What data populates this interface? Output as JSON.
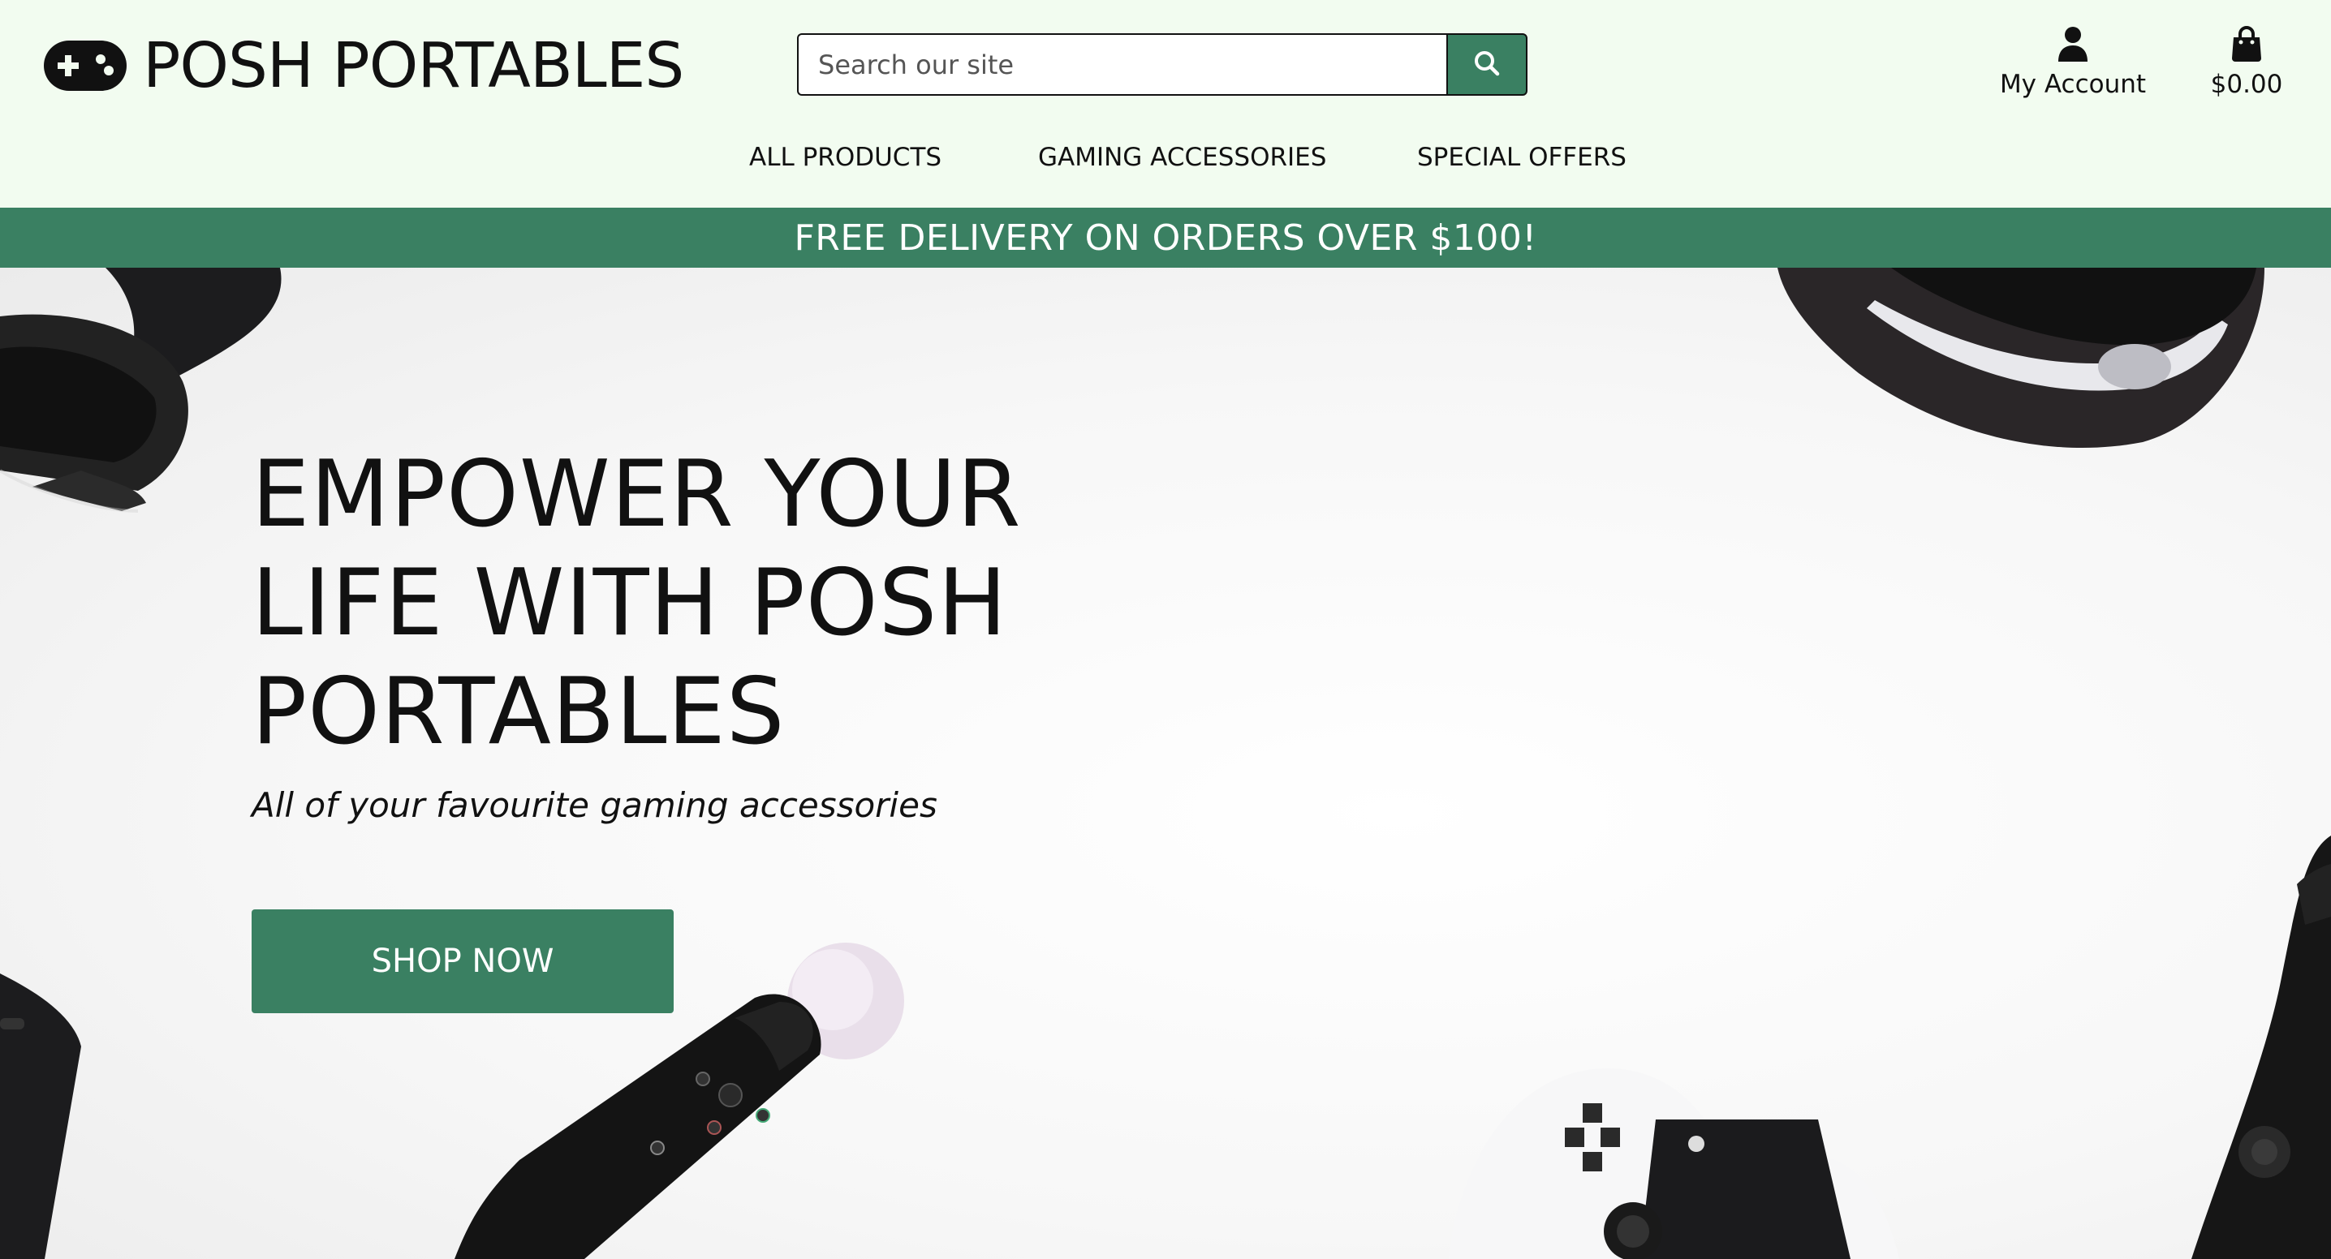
{
  "header": {
    "logo_text": "POSH PORTABLES",
    "logo_icon": "gamepad-icon",
    "search": {
      "placeholder": "Search our site",
      "value": "",
      "button_icon": "search-icon"
    },
    "account": {
      "label": "My Account",
      "icon": "user-icon"
    },
    "basket": {
      "total": "$0.00",
      "icon": "shopping-bag-icon"
    }
  },
  "nav": {
    "items": [
      {
        "label": "ALL PRODUCTS"
      },
      {
        "label": "GAMING ACCESSORIES"
      },
      {
        "label": "SPECIAL OFFERS"
      }
    ]
  },
  "banner": {
    "text": "FREE DELIVERY ON ORDERS OVER $100!"
  },
  "hero": {
    "title_lines": [
      "EMPOWER YOUR",
      "LIFE WITH POSH",
      "PORTABLES"
    ],
    "subtitle": "All of your favourite gaming accessories",
    "cta_label": "SHOP NOW",
    "background": "gaming-accessories-photo"
  },
  "colors": {
    "brand_green": "#3a8062",
    "header_bg": "#f2fcf0",
    "text": "#111111"
  }
}
